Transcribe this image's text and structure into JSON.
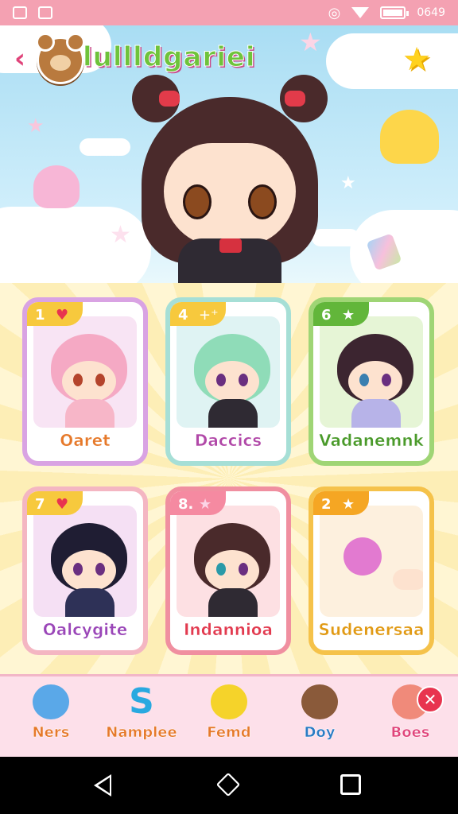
{
  "status_bar": {
    "time": "0649"
  },
  "header": {
    "title": "lullldgariei",
    "back_glyph": "‹",
    "star_glyph": "★"
  },
  "cards": [
    {
      "number": "1",
      "icon": "heart-icon",
      "icon_glyph": "♥",
      "name": "Oaret",
      "frame_color": "#d9a3e3",
      "badge_color": "#f7c93d",
      "name_color": "#e6792a",
      "bg": "#f8e4f4"
    },
    {
      "number": "4",
      "icon": "sparkle-icon",
      "icon_glyph": "+⁺",
      "name": "Daccics",
      "frame_color": "#a6dfd6",
      "badge_color": "#f7c93d",
      "name_color": "#b148a8",
      "bg": "#dff3f3"
    },
    {
      "number": "6",
      "icon": "star-icon",
      "icon_glyph": "★",
      "name": "Vadanemnk",
      "frame_color": "#9fd575",
      "badge_color": "#62b63a",
      "name_color": "#4a9a2a",
      "bg": "#e6f5d6"
    },
    {
      "number": "7",
      "icon": "heart-icon",
      "icon_glyph": "♥",
      "name": "Oalcygite",
      "frame_color": "#f4b6c2",
      "badge_color": "#f7c93d",
      "name_color": "#9a46b8",
      "bg": "#f5e0f4"
    },
    {
      "number": "8.",
      "icon": "star-icon",
      "icon_glyph": "★",
      "name": "Indannioa",
      "frame_color": "#f08fa0",
      "badge_color": "#f58aa1",
      "name_color": "#e23a4f",
      "bg": "#fde0e3"
    },
    {
      "number": "2",
      "icon": "star-icon",
      "icon_glyph": "★",
      "name": "Sudenersaa",
      "frame_color": "#f5c24a",
      "badge_color": "#f5a623",
      "name_color": "#e19a14",
      "bg": "#fdf0de"
    }
  ],
  "nav": [
    {
      "label": "Ners",
      "icon": "planet-icon",
      "color": "#e6792a",
      "icon_color": "#5aa8e8"
    },
    {
      "label": "Namplee",
      "icon": "s-letter-icon",
      "color": "#e6792a",
      "icon_color": "#29a9e0"
    },
    {
      "label": "Femd",
      "icon": "chick-icon",
      "color": "#e6792a",
      "icon_color": "#f5d32a"
    },
    {
      "label": "Doy",
      "icon": "bear-icon",
      "color": "#2a7bc4",
      "icon_color": "#8a5a3a"
    },
    {
      "label": "Boes",
      "icon": "bear-pink-icon",
      "color": "#e0447a",
      "icon_color": "#f08a7a"
    }
  ]
}
